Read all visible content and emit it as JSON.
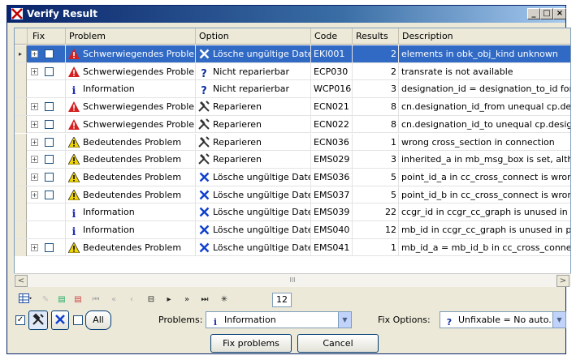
{
  "window": {
    "title": "Verify Result",
    "controls": [
      "_",
      "□",
      "×"
    ]
  },
  "columns": [
    "Fix",
    "Problem",
    "Option",
    "Code",
    "Results",
    "Description"
  ],
  "rows": [
    {
      "expand": true,
      "checkbox": true,
      "problem_icon": "error-triangle-icon",
      "problem": "Schwerwiegendes Problem",
      "option_icon": "delete-x-icon",
      "option": "Lösche ungültige Daten",
      "code": "EKI001",
      "results": "2",
      "description": "elements in obk_obj_kind unknown",
      "selected": true
    },
    {
      "expand": true,
      "checkbox": true,
      "problem_icon": "error-triangle-icon",
      "problem": "Schwerwiegendes Problem",
      "option_icon": "question-icon",
      "option": "Nicht reparierbar",
      "code": "ECP030",
      "results": "2",
      "description": "transrate is not available"
    },
    {
      "expand": false,
      "checkbox": false,
      "problem_icon": "info-icon",
      "problem": "Information",
      "option_icon": "question-icon",
      "option": "Nicht reparierbar",
      "code": "WCP016",
      "results": "3",
      "description": "designation_id = designation_to_id for line"
    },
    {
      "expand": true,
      "checkbox": true,
      "problem_icon": "error-triangle-icon",
      "problem": "Schwerwiegendes Problem",
      "option_icon": "repair-tools-icon",
      "option": "Reparieren",
      "code": "ECN021",
      "results": "8",
      "description": "cn.designation_id_from unequal cp.designa"
    },
    {
      "expand": true,
      "checkbox": true,
      "problem_icon": "error-triangle-icon",
      "problem": "Schwerwiegendes Problem",
      "option_icon": "repair-tools-icon",
      "option": "Reparieren",
      "code": "ECN022",
      "results": "8",
      "description": "cn.designation_id_to unequal cp.designatio"
    },
    {
      "expand": true,
      "checkbox": true,
      "problem_icon": "warning-triangle-icon",
      "problem": "Bedeutendes Problem",
      "option_icon": "repair-tools-icon",
      "option": "Reparieren",
      "code": "ECN036",
      "results": "1",
      "description": "wrong cross_section in connection"
    },
    {
      "expand": true,
      "checkbox": true,
      "problem_icon": "warning-triangle-icon",
      "problem": "Bedeutendes Problem",
      "option_icon": "repair-tools-icon",
      "option": "Reparieren",
      "code": "EMS029",
      "results": "3",
      "description": "inherited_a in mb_msg_box is set, although"
    },
    {
      "expand": true,
      "checkbox": true,
      "problem_icon": "warning-triangle-icon",
      "problem": "Bedeutendes Problem",
      "option_icon": "delete-x-icon",
      "option": "Lösche ungültige Daten",
      "code": "EMS036",
      "results": "5",
      "description": "point_id_a in cc_cross_connect is wrong"
    },
    {
      "expand": true,
      "checkbox": true,
      "problem_icon": "warning-triangle-icon",
      "problem": "Bedeutendes Problem",
      "option_icon": "delete-x-icon",
      "option": "Lösche ungültige Daten",
      "code": "EMS037",
      "results": "5",
      "description": "point_id_b in cc_cross_connect is wrong"
    },
    {
      "expand": false,
      "checkbox": false,
      "problem_icon": "info-icon",
      "problem": "Information",
      "option_icon": "delete-x-icon",
      "option": "Lösche ungültige Daten",
      "code": "EMS039",
      "results": "22",
      "description": "ccgr_id in ccgr_cc_graph is unused in cc"
    },
    {
      "expand": false,
      "checkbox": false,
      "problem_icon": "info-icon",
      "problem": "Information",
      "option_icon": "delete-x-icon",
      "option": "Lösche ungültige Daten",
      "code": "EMS040",
      "results": "12",
      "description": "mb_id in ccgr_cc_graph is unused in pus"
    },
    {
      "expand": true,
      "checkbox": true,
      "problem_icon": "warning-triangle-icon",
      "problem": "Bedeutendes Problem",
      "option_icon": "delete-x-icon",
      "option": "Lösche ungültige Daten",
      "code": "EMS041",
      "results": "1",
      "description": "mb_id_a = mb_id_b in cc_cross_connect"
    }
  ],
  "scrollbar": {
    "thumb_label": "III"
  },
  "navigator": {
    "count": "12"
  },
  "options": {
    "all_label": "All",
    "problems_label": "Problems:",
    "problems_value": "Information",
    "fix_options_label": "Fix Options:",
    "fix_options_value": "Unfixable = No auto..."
  },
  "buttons": {
    "fix": "Fix problems",
    "cancel": "Cancel"
  },
  "colors": {
    "selection": "#316ac5",
    "error": "#d42020",
    "warning": "#f2d600",
    "info": "#2030b0",
    "delete": "#1040d0"
  }
}
